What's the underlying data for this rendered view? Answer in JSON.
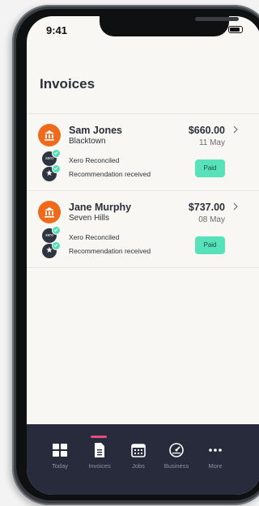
{
  "status_bar": {
    "time": "9:41"
  },
  "page": {
    "title": "Invoices"
  },
  "invoices": [
    {
      "name": "Sam Jones",
      "location": "Blacktown",
      "amount": "$660.00",
      "date": "11 May",
      "xero_text": "Xero Reconciled",
      "recommendation_text": "Recommendation received",
      "status": "Paid",
      "xero_logo": "xero"
    },
    {
      "name": "Jane Murphy",
      "location": "Seven Hills",
      "amount": "$737.00",
      "date": "08 May",
      "xero_text": "Xero Reconciled",
      "recommendation_text": "Recommendation received",
      "status": "Paid",
      "xero_logo": "xero"
    }
  ],
  "tab_bar": {
    "tabs": [
      {
        "label": "Today",
        "icon": "grid-icon"
      },
      {
        "label": "Invoices",
        "icon": "document-icon",
        "active": true
      },
      {
        "label": "Jobs",
        "icon": "calendar-icon"
      },
      {
        "label": "Business",
        "icon": "gauge-icon"
      },
      {
        "label": "More",
        "icon": "more-dots-icon"
      }
    ]
  },
  "colors": {
    "accent_orange": "#ef6a1a",
    "paid_green": "#58e2b9",
    "tab_bar_bg": "#272b3b",
    "active_indicator": "#e64d79",
    "check_green": "#4fe0b8"
  }
}
